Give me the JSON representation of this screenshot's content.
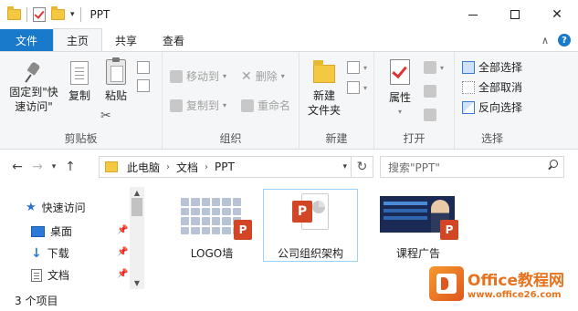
{
  "window": {
    "title": "PPT",
    "minimize_glyph": "—",
    "close_glyph": "✕"
  },
  "ribbon_tabs": {
    "file": "文件",
    "home": "主页",
    "share": "共享",
    "view": "查看"
  },
  "ribbon": {
    "clipboard": {
      "label": "剪贴板",
      "pin": "固定到\"快\n速访问\"",
      "copy": "复制",
      "paste": "粘贴"
    },
    "organize": {
      "label": "组织",
      "move_to": "移动到",
      "copy_to": "复制到",
      "delete": "删除",
      "rename": "重命名"
    },
    "new": {
      "label": "新建",
      "new_folder": "新建\n文件夹"
    },
    "open": {
      "label": "打开",
      "properties": "属性"
    },
    "select": {
      "label": "选择",
      "select_all": "全部选择",
      "select_none": "全部取消",
      "invert": "反向选择"
    }
  },
  "address": {
    "crumbs": [
      "此电脑",
      "文档",
      "PPT"
    ],
    "search_placeholder": "搜索\"PPT\""
  },
  "nav_pane": {
    "quick_access": "快速访问",
    "items": [
      {
        "label": "桌面",
        "icon": "desktop-icon"
      },
      {
        "label": "下载",
        "icon": "download-icon"
      },
      {
        "label": "文档",
        "icon": "documents-icon"
      }
    ]
  },
  "files": [
    {
      "name": "LOGO墙",
      "selected": false
    },
    {
      "name": "公司组织架构",
      "selected": true
    },
    {
      "name": "课程广告",
      "selected": false
    }
  ],
  "status": {
    "item_count": "3 个项目"
  },
  "watermark": {
    "line1": "Office教程网",
    "line2": "www.office26.com"
  }
}
